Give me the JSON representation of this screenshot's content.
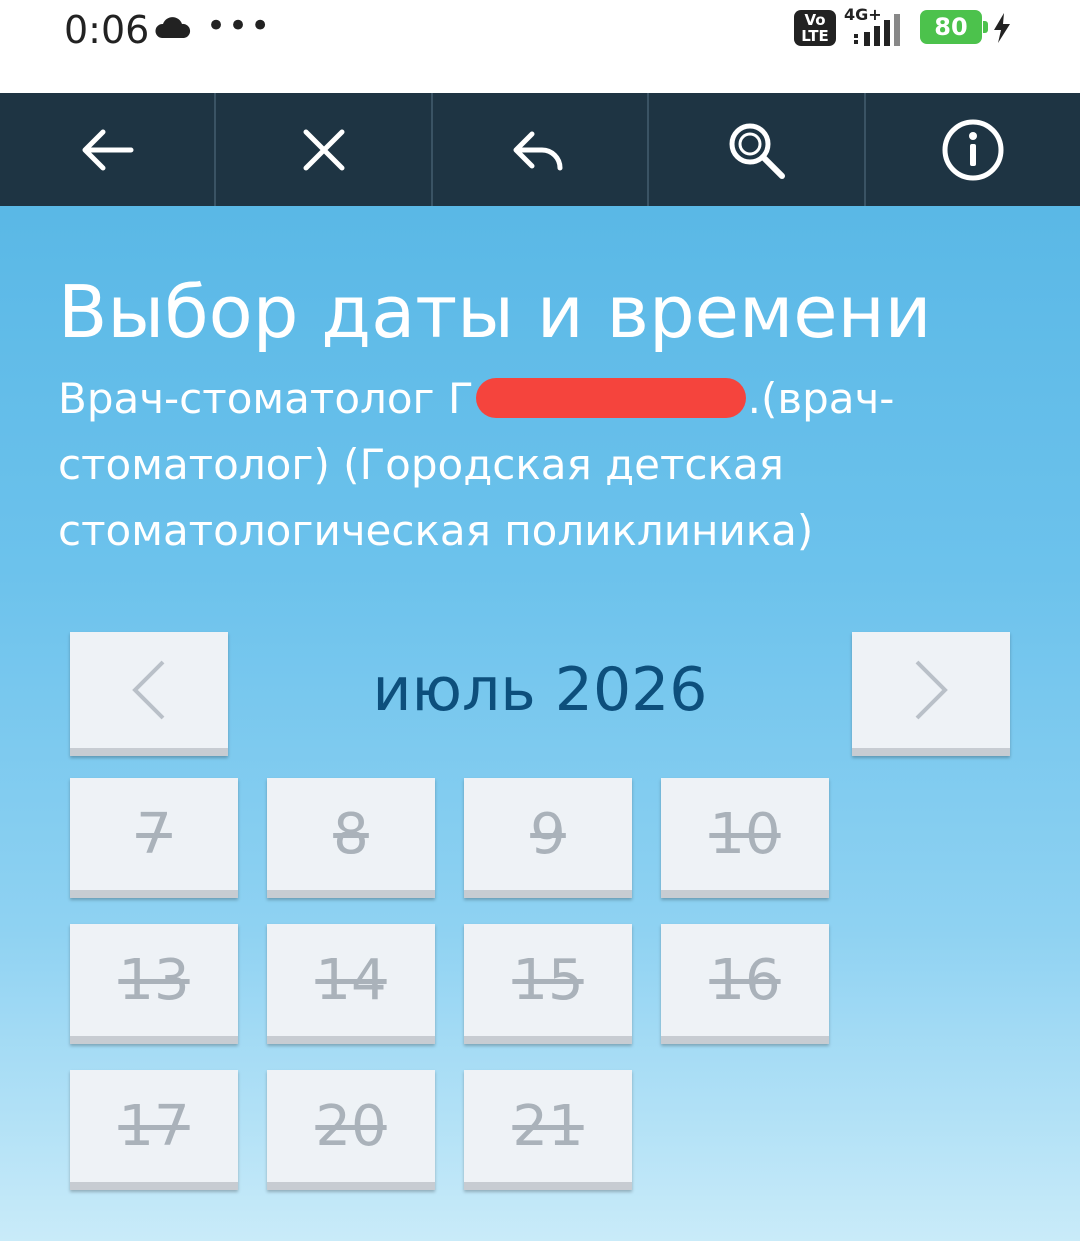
{
  "status_bar": {
    "time": "0:06",
    "dots": "•••",
    "volte": "Vo LTE",
    "network": "4G+",
    "battery": "80"
  },
  "toolbar": {
    "buttons": [
      {
        "name": "back-arrow-icon"
      },
      {
        "name": "close-icon"
      },
      {
        "name": "reply-icon"
      },
      {
        "name": "search-icon"
      },
      {
        "name": "info-icon"
      }
    ]
  },
  "page": {
    "title": "Выбор даты и времени",
    "doctor_prefix": "Врач-стоматолог Г",
    "doctor_suffix": ".(врач-стоматолог) (Городская детская стоматологическая поликлиника)"
  },
  "calendar": {
    "month": "июль 2026",
    "days": [
      "7",
      "8",
      "9",
      "10",
      "13",
      "14",
      "15",
      "16",
      "17",
      "20",
      "21"
    ],
    "day_state": "unavailable"
  },
  "colors": {
    "toolbar_bg": "#1e3443",
    "month_text": "#0d4f7c",
    "disabled_day_text": "#aab2ba",
    "redaction": "#f5443d"
  }
}
